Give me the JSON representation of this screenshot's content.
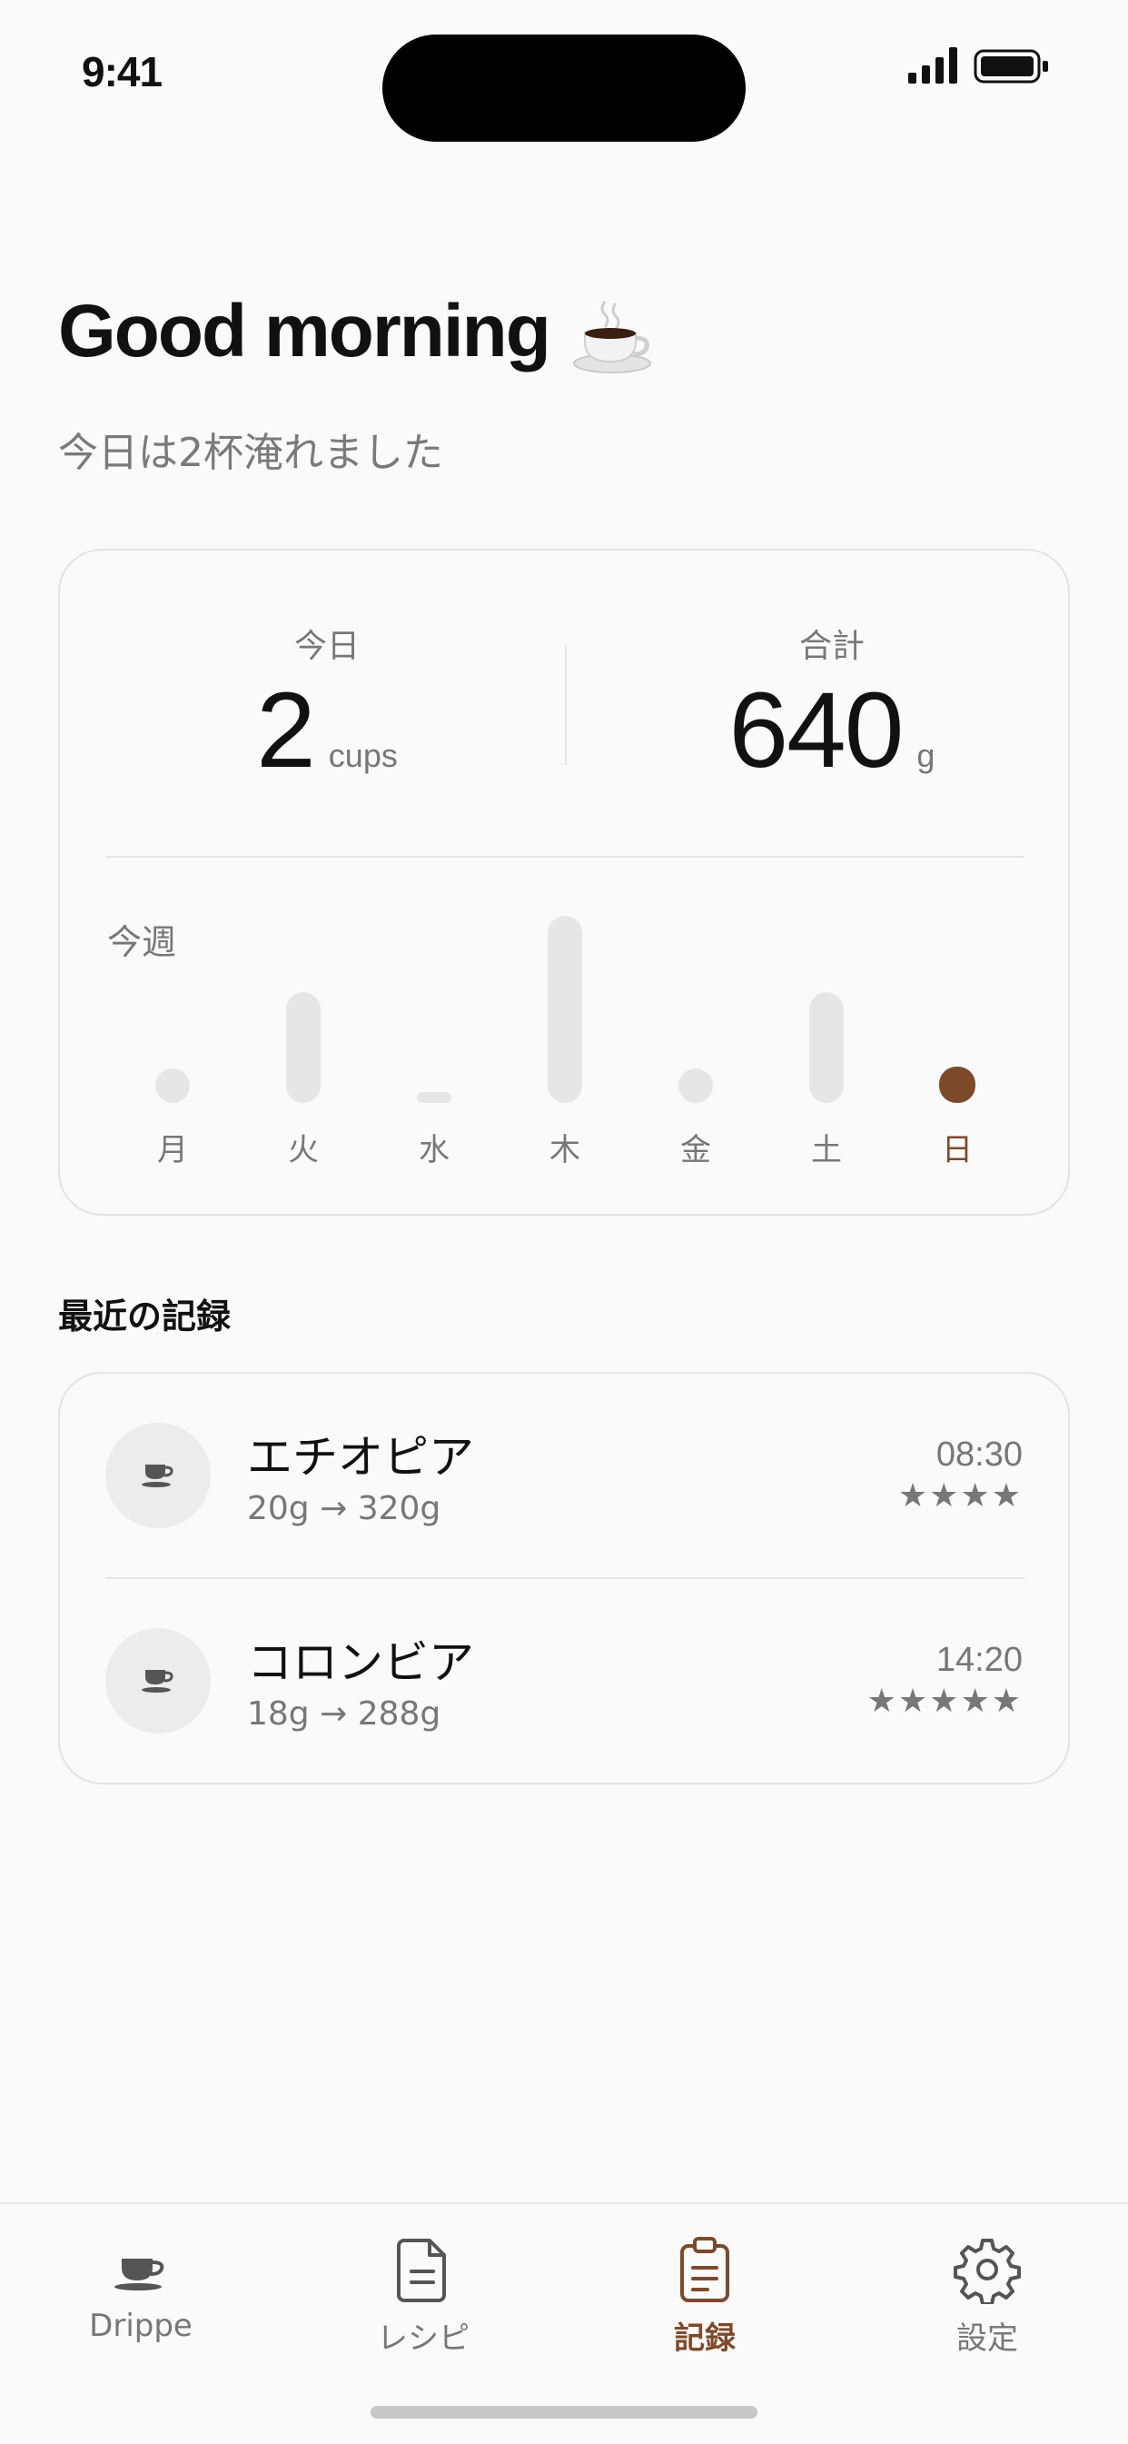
{
  "status_bar": {
    "time": "9:41"
  },
  "greeting": {
    "title": "Good morning",
    "emoji_icon": "coffee-cup-icon",
    "subtitle": "今日は2杯淹れました"
  },
  "stats": {
    "today": {
      "label": "今日",
      "value": "2",
      "unit": "cups"
    },
    "total": {
      "label": "合計",
      "value": "640",
      "unit": "g"
    }
  },
  "week": {
    "title": "今週",
    "days": [
      {
        "label": "月",
        "level": 0
      },
      {
        "label": "火",
        "level": 2
      },
      {
        "label": "水",
        "level": -1
      },
      {
        "label": "木",
        "level": 4
      },
      {
        "label": "金",
        "level": 0
      },
      {
        "label": "土",
        "level": 2
      },
      {
        "label": "日",
        "level": 0,
        "today": true
      }
    ],
    "accent_color": "#7c4a2b"
  },
  "recent": {
    "title": "最近の記録",
    "items": [
      {
        "name": "エチオピア",
        "detail": "20g → 320g",
        "time": "08:30",
        "stars": "★★★★",
        "rating": 4
      },
      {
        "name": "コロンビア",
        "detail": "18g → 288g",
        "time": "14:20",
        "stars": "★★★★★",
        "rating": 5
      }
    ]
  },
  "tabbar": {
    "tabs": [
      {
        "label": "Drippe",
        "icon": "coffee-cup-icon",
        "active": false
      },
      {
        "label": "レシピ",
        "icon": "document-icon",
        "active": false
      },
      {
        "label": "記録",
        "icon": "clipboard-icon",
        "active": true
      },
      {
        "label": "設定",
        "icon": "gear-icon",
        "active": false
      }
    ]
  }
}
